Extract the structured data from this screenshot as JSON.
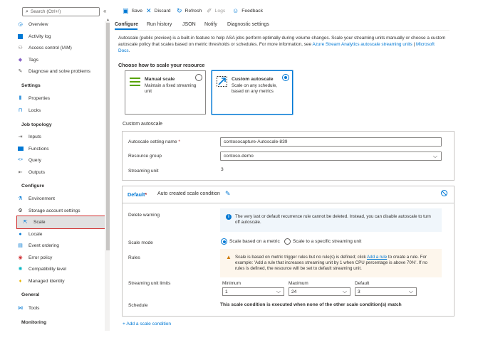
{
  "sidebar": {
    "search_placeholder": "Search (Ctrl+/)",
    "collapse_glyph": "«",
    "items": [
      {
        "label": "Overview",
        "icon": "overview-icon"
      },
      {
        "label": "Activity log",
        "icon": "activity-log-icon"
      },
      {
        "label": "Access control (IAM)",
        "icon": "iam-icon"
      },
      {
        "label": "Tags",
        "icon": "tag-icon"
      },
      {
        "label": "Diagnose and solve problems",
        "icon": "wrench-icon"
      }
    ],
    "sections": {
      "settings": "Settings",
      "job_topology": "Job topology",
      "configure": "Configure",
      "general": "General",
      "monitoring": "Monitoring"
    },
    "settings_items": [
      {
        "label": "Properties",
        "icon": "properties-icon"
      },
      {
        "label": "Locks",
        "icon": "lock-icon"
      }
    ],
    "topology_items": [
      {
        "label": "Inputs",
        "icon": "inputs-icon"
      },
      {
        "label": "Functions",
        "icon": "functions-icon"
      },
      {
        "label": "Query",
        "icon": "query-icon"
      },
      {
        "label": "Outputs",
        "icon": "outputs-icon"
      }
    ],
    "configure_items": [
      {
        "label": "Environment",
        "icon": "environment-icon"
      },
      {
        "label": "Storage account settings",
        "icon": "gear-icon"
      },
      {
        "label": "Scale",
        "icon": "scale-icon",
        "selected": true
      },
      {
        "label": "Locale",
        "icon": "locale-icon"
      },
      {
        "label": "Event ordering",
        "icon": "event-ordering-icon"
      },
      {
        "label": "Error policy",
        "icon": "error-policy-icon"
      },
      {
        "label": "Compatibility level",
        "icon": "compatibility-icon"
      },
      {
        "label": "Managed Identity",
        "icon": "key-icon"
      }
    ],
    "general_items": [
      {
        "label": "Tools",
        "icon": "tools-icon"
      }
    ]
  },
  "toolbar": {
    "save": "Save",
    "discard": "Discard",
    "refresh": "Refresh",
    "logs": "Logs",
    "feedback": "Feedback"
  },
  "tabs": [
    "Configure",
    "Run history",
    "JSON",
    "Notify",
    "Diagnostic settings"
  ],
  "description": {
    "text": "Autoscale (public preview) is a built-in feature to help ASA jobs perform optimally during volume changes. Scale your streaming units manually or choose a custom autoscale policy that scales based on metric thresholds or schedules. For more information, see ",
    "link1": "Azure Stream Analytics autoscale streaming units",
    "sep": " | ",
    "link2": "Microsoft Docs",
    "end": "."
  },
  "choose_title": "Choose how to scale your resource",
  "cards": {
    "manual": {
      "title": "Manual scale",
      "desc": "Maintain a fixed streaming unit"
    },
    "custom": {
      "title": "Custom autoscale",
      "desc": "Scale on any schedule, based on any metrics"
    }
  },
  "custom_section_title": "Custom autoscale",
  "form": {
    "setting_name_label": "Autoscale setting name",
    "required_star": "*",
    "setting_name_value": "contosocapture-Autoscale-839",
    "resource_group_label": "Resource group",
    "resource_group_value": "contoso-demo",
    "streaming_unit_label": "Streaming unit",
    "streaming_unit_value": "3"
  },
  "condition": {
    "name": "Default",
    "star": "*",
    "subtitle": "Auto created scale condition",
    "delete_warning_label": "Delete warning",
    "delete_warning_text": "The very last or default recurrence rule cannot be deleted. Instead, you can disable autoscale to turn off autoscale.",
    "scale_mode_label": "Scale mode",
    "scale_mode_option1": "Scale based on a metric",
    "scale_mode_option2": "Scale to a specific streaming unit",
    "rules_label": "Rules",
    "rules_warning_pre": "Scale is based on metric trigger rules but no rule(s) is defined; click ",
    "rules_warning_link": "Add a rule",
    "rules_warning_post": " to create a rule. For example: 'Add a rule that increases streaming unit by 1 when CPU percentage is above 70%'. If no rules is defined, the resource will be set to default streaming unit.",
    "limits_label": "Streaming unit limits",
    "minimum_label": "Minimum",
    "minimum_value": "1",
    "maximum_label": "Maximum",
    "maximum_value": "24",
    "default_label": "Default",
    "default_value": "3",
    "schedule_label": "Schedule",
    "schedule_text": "This scale condition is executed when none of the other scale condition(s) match"
  },
  "add_condition": "+ Add a scale condition",
  "colors": {
    "accent": "#0078d4",
    "selection_border": "#d12f2f",
    "warning": "#d07a00"
  }
}
